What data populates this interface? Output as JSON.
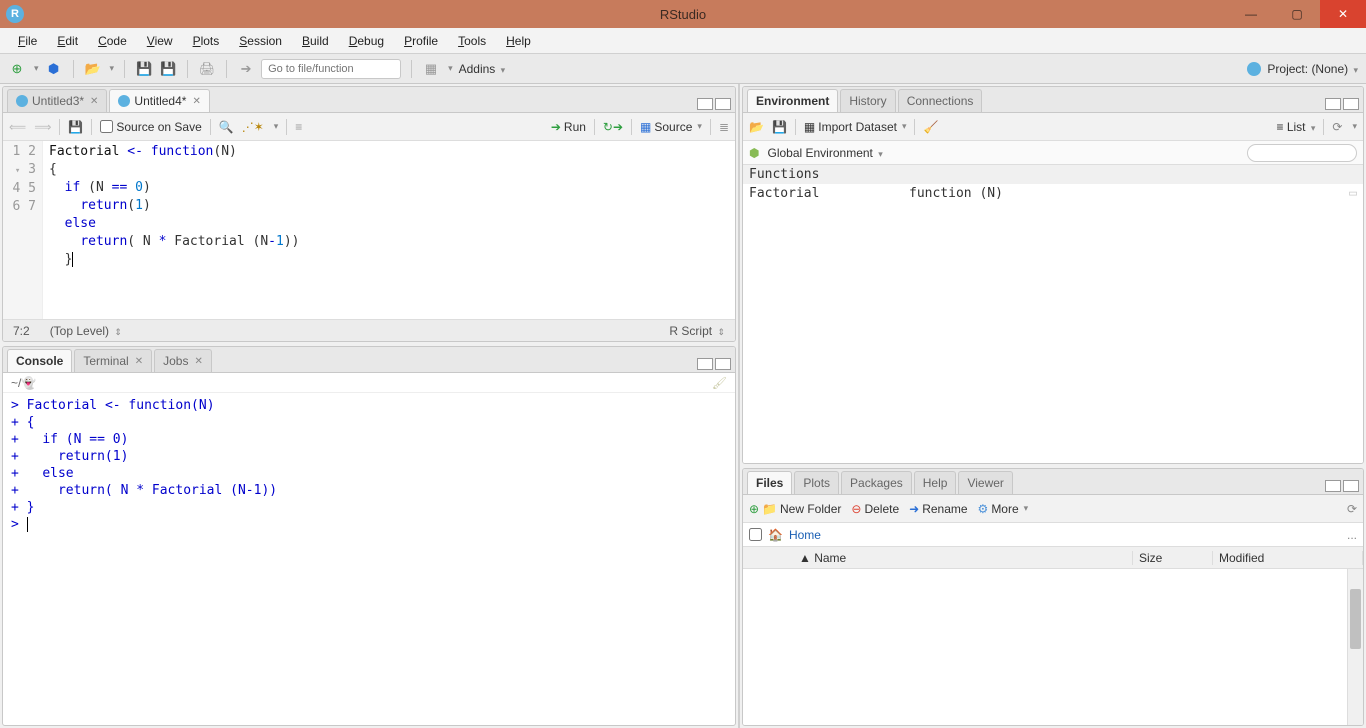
{
  "title": "RStudio",
  "menubar": [
    "File",
    "Edit",
    "Code",
    "View",
    "Plots",
    "Session",
    "Build",
    "Debug",
    "Profile",
    "Tools",
    "Help"
  ],
  "toolbar": {
    "goto_placeholder": "Go to file/function",
    "addins": "Addins",
    "project": "Project: (None)"
  },
  "source": {
    "tabs": [
      {
        "label": "Untitled3*"
      },
      {
        "label": "Untitled4*"
      }
    ],
    "toolbar": {
      "source_on_save": "Source on Save",
      "run": "Run",
      "source": "Source"
    },
    "gutter": [
      "1",
      "2",
      "3",
      "4",
      "5",
      "6",
      "7"
    ],
    "status_left": "7:2",
    "status_mid": "(Top Level)",
    "status_right": "R Script",
    "code_lines": [
      {
        "raw": "Factorial <- function(N)"
      },
      {
        "raw": "{"
      },
      {
        "raw": "  if (N == 0)"
      },
      {
        "raw": "    return(1)"
      },
      {
        "raw": "  else"
      },
      {
        "raw": "    return( N * Factorial (N-1))"
      },
      {
        "raw": "  }|"
      }
    ]
  },
  "console": {
    "tabs": [
      "Console",
      "Terminal",
      "Jobs"
    ],
    "path": "~/",
    "lines": [
      "> Factorial <- function(N)",
      "+ {",
      "+   if (N == 0)",
      "+     return(1)",
      "+   else",
      "+     return( N * Factorial (N-1))",
      "+ }",
      "> |"
    ]
  },
  "env": {
    "tabs": [
      "Environment",
      "History",
      "Connections"
    ],
    "toolbar": {
      "import": "Import Dataset",
      "scope": "Global Environment",
      "list": "List"
    },
    "section": "Functions",
    "rows": [
      {
        "name": "Factorial",
        "value": "function (N)"
      }
    ]
  },
  "files": {
    "tabs": [
      "Files",
      "Plots",
      "Packages",
      "Help",
      "Viewer"
    ],
    "toolbar": {
      "new_folder": "New Folder",
      "delete": "Delete",
      "rename": "Rename",
      "more": "More"
    },
    "path": "Home",
    "headers": [
      "Name",
      "Size",
      "Modified"
    ]
  }
}
